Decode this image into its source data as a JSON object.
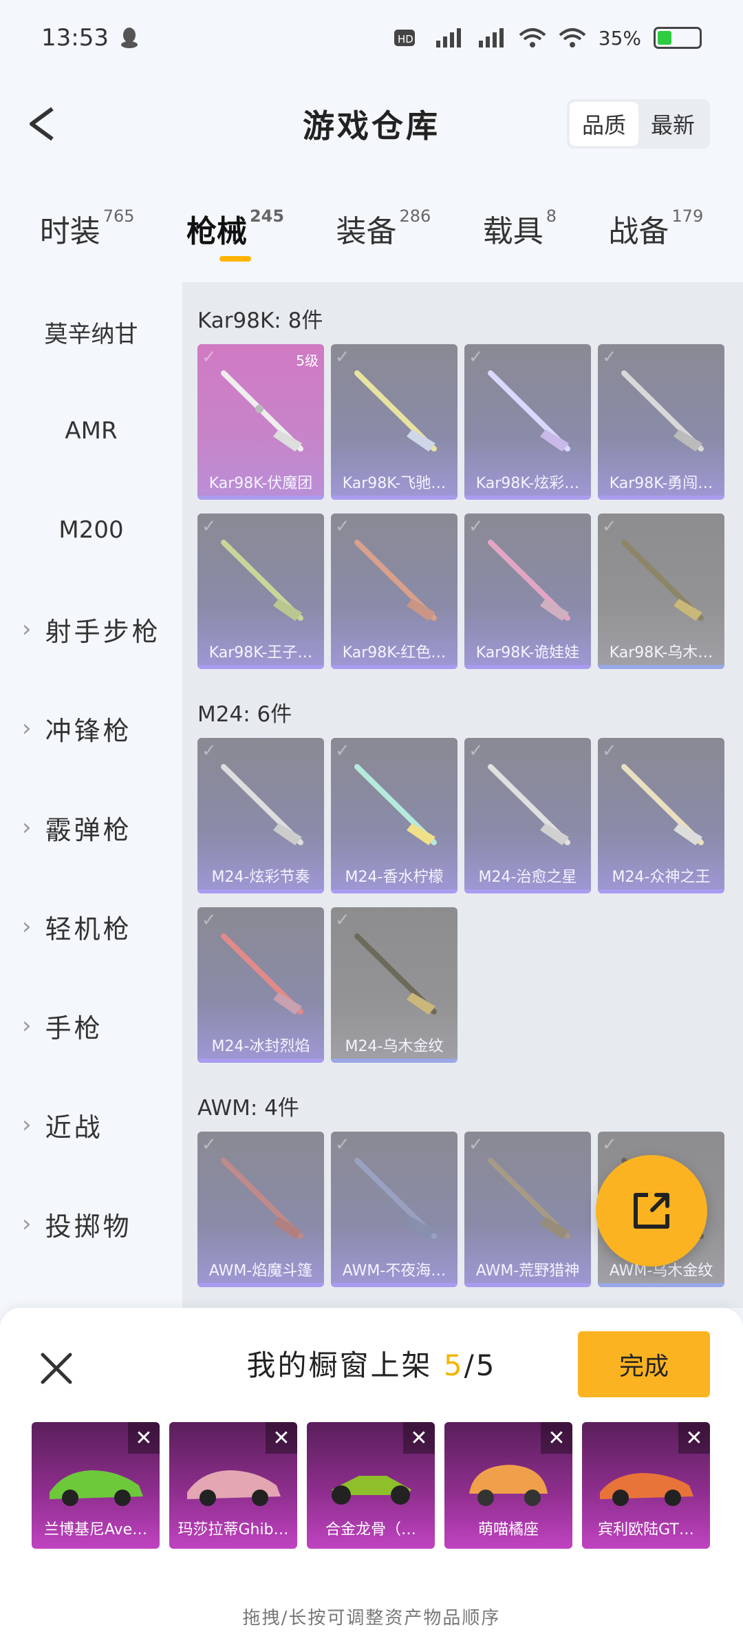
{
  "status": {
    "time": "13:53",
    "network": "4G 4G+",
    "battery": "35%",
    "battery_level": 0.35
  },
  "header": {
    "title": "游戏仓库",
    "sort_options": [
      "品质",
      "最新"
    ]
  },
  "tabs": [
    {
      "label": "时装",
      "count": "765"
    },
    {
      "label": "枪械",
      "count": "245"
    },
    {
      "label": "装备",
      "count": "286"
    },
    {
      "label": "载具",
      "count": "8"
    },
    {
      "label": "战备",
      "count": "179"
    }
  ],
  "sidebar": [
    {
      "label": "莫辛纳甘"
    },
    {
      "label": "AMR"
    },
    {
      "label": "M200"
    },
    {
      "label": "射手步枪"
    },
    {
      "label": "冲锋枪"
    },
    {
      "label": "霰弹枪"
    },
    {
      "label": "轻机枪"
    },
    {
      "label": "手枪"
    },
    {
      "label": "近战"
    },
    {
      "label": "投掷物"
    }
  ],
  "sections": [
    {
      "title": "Kar98K: 8件",
      "items": [
        {
          "name": "Kar98K-伏魔团",
          "level": "5级"
        },
        {
          "name": "Kar98K-飞驰…"
        },
        {
          "name": "Kar98K-炫彩…"
        },
        {
          "name": "Kar98K-勇闯…"
        },
        {
          "name": "Kar98K-王子…"
        },
        {
          "name": "Kar98K-红色…"
        },
        {
          "name": "Kar98K-诡娃娃"
        },
        {
          "name": "Kar98K-乌木…"
        }
      ]
    },
    {
      "title": "M24: 6件",
      "items": [
        {
          "name": "M24-炫彩节奏"
        },
        {
          "name": "M24-香水柠檬"
        },
        {
          "name": "M24-治愈之星"
        },
        {
          "name": "M24-众神之王"
        },
        {
          "name": "M24-冰封烈焰"
        },
        {
          "name": "M24-乌木金纹"
        }
      ]
    },
    {
      "title": "AWM: 4件",
      "items": [
        {
          "name": "AWM-焰魔斗篷"
        },
        {
          "name": "AWM-不夜海…"
        },
        {
          "name": "AWM-荒野猎神"
        },
        {
          "name": "AWM-乌木金纹"
        }
      ]
    }
  ],
  "sheet": {
    "title_prefix": "我的橱窗上架",
    "count": "5",
    "total": "/5",
    "done_label": "完成",
    "items": [
      {
        "name": "兰博基尼Ave…"
      },
      {
        "name": "玛莎拉蒂Ghib…"
      },
      {
        "name": "合金龙骨（…"
      },
      {
        "name": "萌喵橘座"
      },
      {
        "name": "宾利欧陆GT…"
      }
    ],
    "hint": "拖拽/长按可调整资产物品顺序"
  }
}
